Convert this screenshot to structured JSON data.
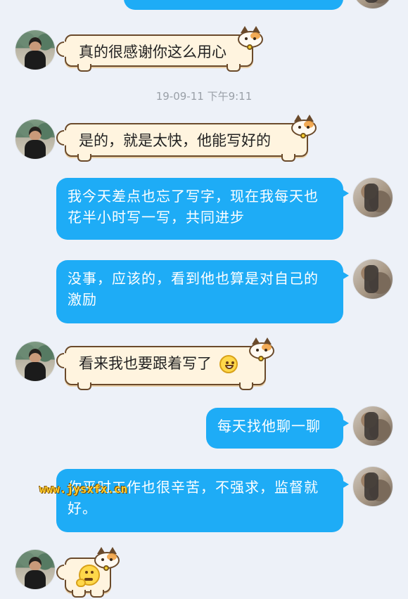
{
  "colors": {
    "background": "#edf1f8",
    "outgoing_bubble": "#1eacf6",
    "incoming_bubble": "#fff4df",
    "incoming_border": "#6a4a2b",
    "timestamp_text": "#9aa0a8"
  },
  "timestamp": "19-09-11 下午9:11",
  "messages": [
    {
      "side": "incoming",
      "text": "真的很感谢你这么用心"
    },
    {
      "side": "incoming",
      "text": "是的，就是太快，他能写好的"
    },
    {
      "side": "outgoing",
      "text": "我今天差点也忘了写字，现在我每天也花半小时写一写，共同进步"
    },
    {
      "side": "outgoing",
      "text": "没事，应该的，看到他也算是对自己的激励"
    },
    {
      "side": "incoming",
      "text": "看来我也要跟着写了",
      "emoji": "grinning-face"
    },
    {
      "side": "outgoing",
      "text": "每天找他聊一聊"
    },
    {
      "side": "outgoing",
      "text": "你平时工作也很辛苦，不强求，监督就好。"
    },
    {
      "side": "incoming",
      "text": "",
      "emoji": "thinking-face"
    }
  ],
  "watermark": "www.jysxfx.cn"
}
